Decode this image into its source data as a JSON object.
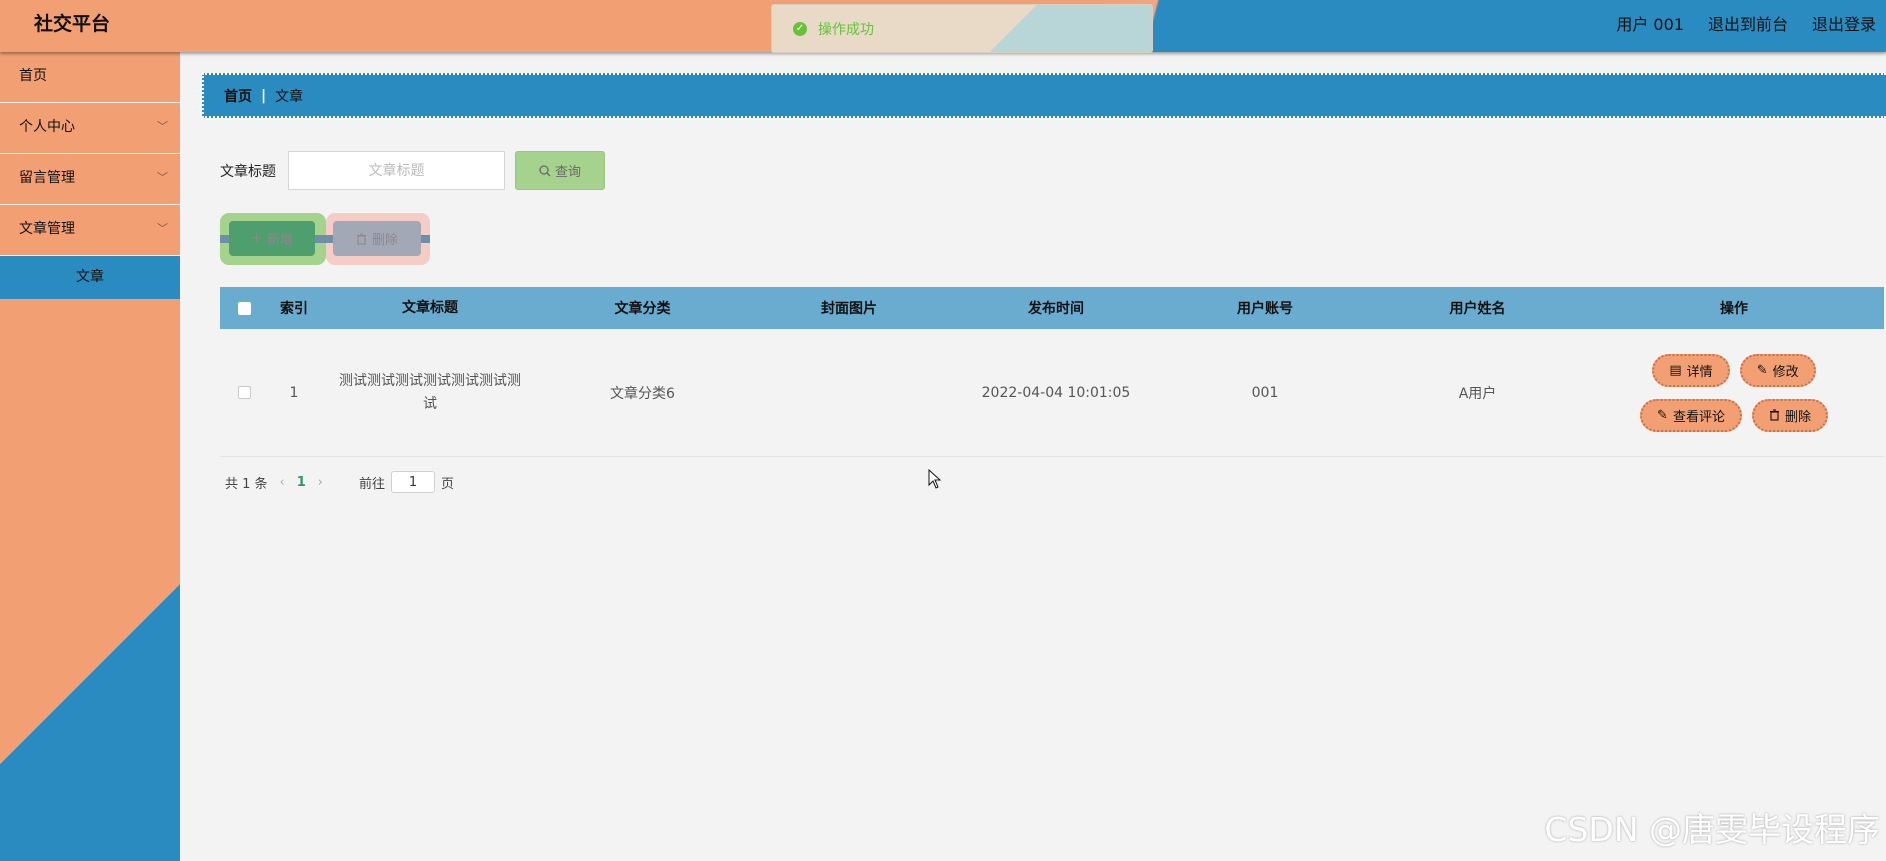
{
  "app": {
    "title": "社交平台",
    "user_label": "用户 001",
    "exit_front_label": "退出到前台",
    "logout_label": "退出登录"
  },
  "toast": {
    "message": "操作成功"
  },
  "sidebar": {
    "items": [
      {
        "label": "首页"
      },
      {
        "label": "个人中心"
      },
      {
        "label": "留言管理"
      },
      {
        "label": "文章管理"
      }
    ],
    "active_sub": "文章"
  },
  "breadcrumb": {
    "home": "首页",
    "current": "文章"
  },
  "search": {
    "label": "文章标题",
    "placeholder": "文章标题",
    "button_label": "查询"
  },
  "actions": {
    "add_label": "新增",
    "delete_label": "删除"
  },
  "table": {
    "headers": [
      "索引",
      "文章标题",
      "文章分类",
      "封面图片",
      "发布时间",
      "用户账号",
      "用户姓名",
      "操作"
    ],
    "rows": [
      {
        "index": "1",
        "title": "测试测试测试测试测试测试测试",
        "category": "文章分类6",
        "cover": "",
        "time": "2022-04-04 10:01:05",
        "account": "001",
        "name": "A用户",
        "ops": {
          "detail": "详情",
          "edit": "修改",
          "comments": "查看评论",
          "delete": "删除"
        }
      }
    ]
  },
  "pagination": {
    "total_text": "共 1 条",
    "current_page": "1",
    "goto_prefix": "前往",
    "goto_value": "1",
    "goto_suffix": "页"
  },
  "watermark": "CSDN @唐雯毕设程序",
  "colors": {
    "accent_orange": "#f39f74",
    "accent_blue": "#2a8bc1",
    "success_green": "#67c23a"
  }
}
